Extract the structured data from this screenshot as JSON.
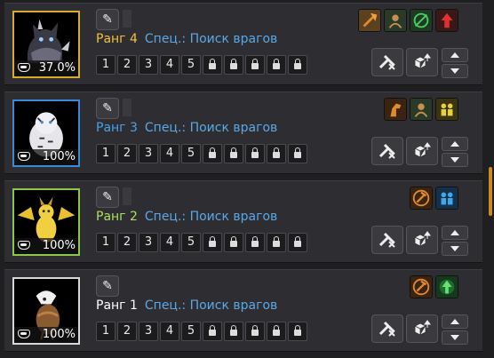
{
  "pets": [
    {
      "rank_label": "Ранг 4",
      "spec_label": "Спец.: Поиск врагов",
      "health": "37.0%",
      "rank_color": "#f0c040",
      "border_color": "#d8aa30",
      "slots": [
        "1",
        "2",
        "3",
        "4",
        "5",
        "lock",
        "lock",
        "lock",
        "lock",
        "lock"
      ],
      "abilities": [
        "axe-icon",
        "tracking-icon",
        "arrows-icon",
        "red-up-arrow-icon"
      ]
    },
    {
      "rank_label": "Ранг 3",
      "spec_label": "Спец.: Поиск врагов",
      "health": "100%",
      "rank_color": "#4aa0e8",
      "border_color": "#3a8ad8",
      "slots": [
        "1",
        "2",
        "3",
        "4",
        "5",
        "lock",
        "lock",
        "lock",
        "lock",
        "lock"
      ],
      "abilities": [
        "horse-icon",
        "tracking-icon",
        "group-buff-icon"
      ]
    },
    {
      "rank_label": "Ранг 2",
      "spec_label": "Спец.: Поиск врагов",
      "health": "100%",
      "rank_color": "#a8e060",
      "border_color": "#8cc848",
      "slots": [
        "1",
        "2",
        "3",
        "4",
        "5",
        "lock",
        "lock",
        "lock",
        "lock",
        "lock"
      ],
      "abilities": [
        "axe-orange-icon",
        "group-buff-blue-icon"
      ]
    },
    {
      "rank_label": "Ранг 1",
      "spec_label": "Спец.: Поиск врагов",
      "health": "100%",
      "rank_color": "#ffffff",
      "border_color": "#d8d8d8",
      "slots": [
        "1",
        "2",
        "3",
        "4",
        "5",
        "lock",
        "lock",
        "lock",
        "lock",
        "lock"
      ],
      "abilities": [
        "axe-orange-icon",
        "green-up-arrow-icon"
      ]
    }
  ],
  "ui": {
    "edit_icon": "pencil-icon",
    "release_icon": "release-paw-icon",
    "boxes_icon": "stow-boxes-icon",
    "move_up_icon": "triangle-up-icon",
    "move_down_icon": "triangle-down-icon",
    "scrollbar_color": "#c98a22"
  }
}
